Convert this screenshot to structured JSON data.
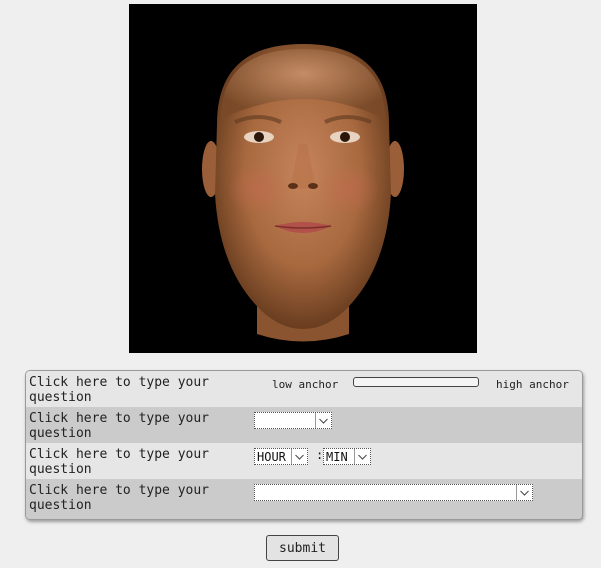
{
  "stimulus": {
    "icon": "face-image",
    "background_color": "#000000"
  },
  "questions": [
    {
      "text": "Click here to type your question",
      "type": "slider",
      "low_anchor": "low anchor",
      "high_anchor": "high anchor"
    },
    {
      "text": "Click here to type your question",
      "type": "dropdown",
      "selected": ""
    },
    {
      "text": "Click here to type your question",
      "type": "time",
      "hour_selected": "HOUR",
      "separator": ":",
      "minute_selected": "MIN"
    },
    {
      "text": "Click here to type your question",
      "type": "dropdown-wide",
      "selected": ""
    }
  ],
  "submit_label": "submit",
  "colors": {
    "row_light": "#e6e6e6",
    "row_dark": "#cbcbcb",
    "page_background": "#efefef"
  }
}
